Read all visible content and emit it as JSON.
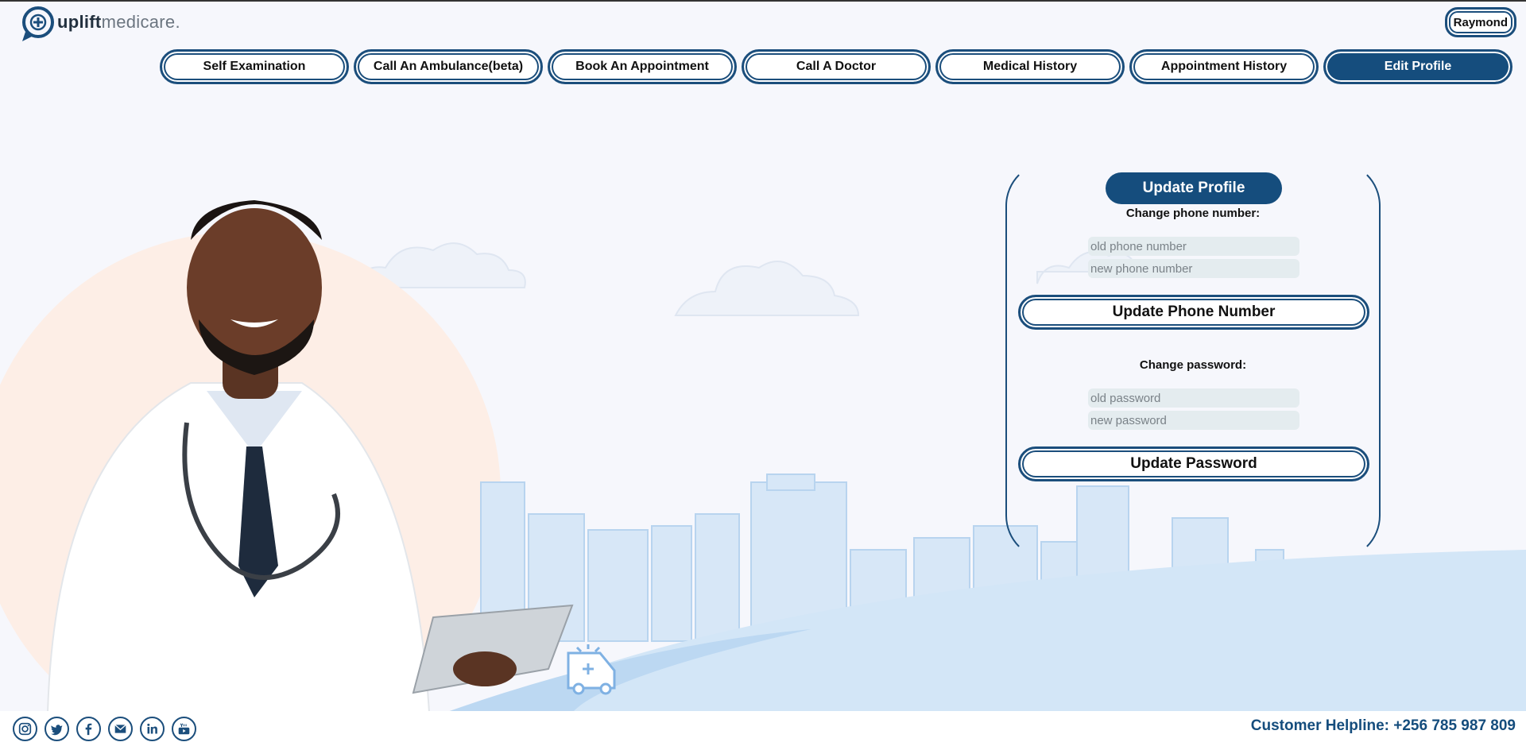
{
  "brand": {
    "name_bold": "uplift",
    "name_light": "medicare."
  },
  "user": {
    "name": "Raymond"
  },
  "nav": [
    {
      "label": "Self Examination",
      "active": false
    },
    {
      "label": "Call An Ambulance(beta)",
      "active": false
    },
    {
      "label": "Book An Appointment",
      "active": false
    },
    {
      "label": "Call A Doctor",
      "active": false
    },
    {
      "label": "Medical History",
      "active": false
    },
    {
      "label": "Appointment History",
      "active": false
    },
    {
      "label": "Edit Profile",
      "active": true
    }
  ],
  "profile_form": {
    "title": "Update Profile",
    "phone_section_label": "Change phone number:",
    "old_phone_placeholder": "old phone number",
    "new_phone_placeholder": "new phone number",
    "update_phone_label": "Update Phone Number",
    "password_section_label": "Change password:",
    "old_password_placeholder": "old password",
    "new_password_placeholder": "new password",
    "update_password_label": "Update Password"
  },
  "footer": {
    "socials": [
      "instagram-icon",
      "twitter-icon",
      "facebook-icon",
      "mail-icon",
      "linkedin-icon",
      "youtube-icon"
    ],
    "helpline": "Customer Helpline: +256 785 987 809"
  },
  "colors": {
    "primary": "#154d7d",
    "background": "#f6f7fc",
    "skyline": "#cfe3f6",
    "peach": "#fdeee6"
  }
}
